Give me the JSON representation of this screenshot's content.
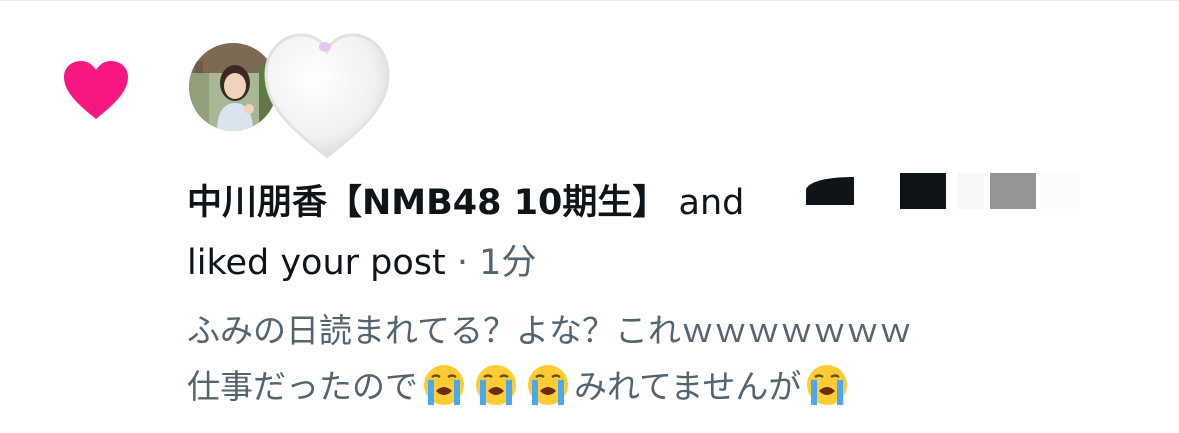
{
  "notification": {
    "type_icon": "heart-icon",
    "type_color": "#f91880",
    "secondary_icon": "white-heart-icon",
    "username": "中川朋香【NMB48 10期生】",
    "and_text": " and",
    "action_text": "liked your post",
    "separator": " · ",
    "time": "1分",
    "reply_line1": "ふみの日読まれてる？よな？これｗｗｗｗｗｗｗ",
    "reply_line2_part1": "仕事だったので",
    "reply_line2_part2": "みれてませんが",
    "reply_emoji": "loudly-crying-face-icon"
  },
  "colors": {
    "primary_text": "#0f1419",
    "secondary_text": "#536471",
    "like_pink": "#f91880"
  }
}
